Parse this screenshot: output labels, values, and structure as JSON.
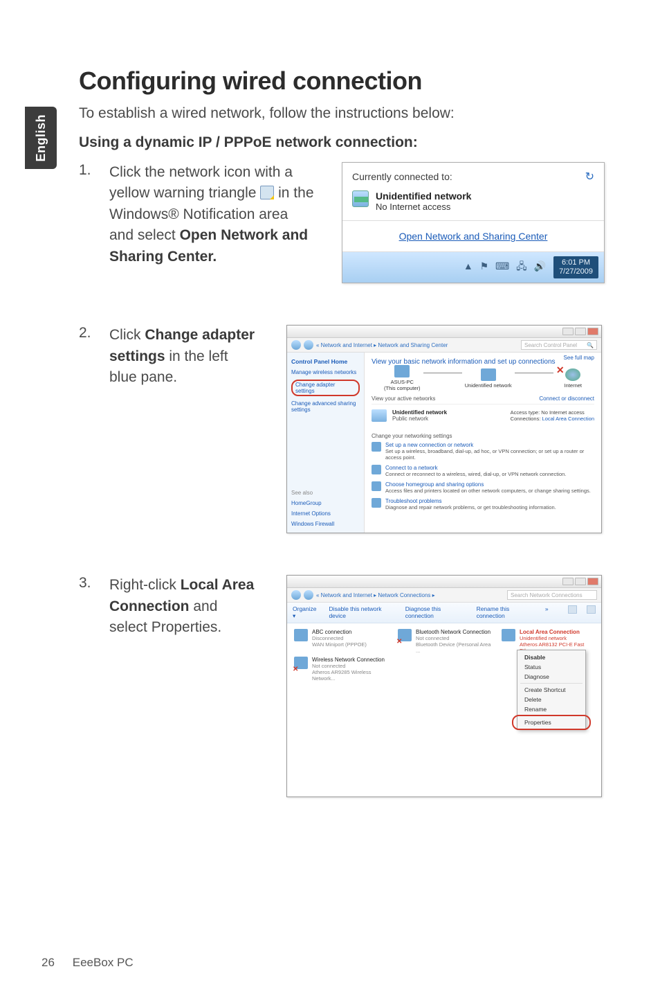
{
  "sideTab": "English",
  "headline": "Configuring wired connection",
  "intro": "To establish a wired network, follow the instructions below:",
  "subhead": "Using a dynamic IP / PPPoE network connection:",
  "steps": {
    "s1": {
      "num": "1.",
      "pre": "Click the network icon with a yellow warning triangle ",
      "mid": " in the Windows® Notification area and select ",
      "bold": "Open Network and Sharing Center."
    },
    "s2": {
      "num": "2.",
      "pre": "Click ",
      "bold": "Change adapter settings",
      "post": " in the left blue pane."
    },
    "s3": {
      "num": "3.",
      "pre": "Right-click ",
      "bold": "Local Area Connection",
      "post": " and select Properties."
    }
  },
  "shot1": {
    "header": "Currently connected to:",
    "refreshGlyph": "↻",
    "netTitle": "Unidentified network",
    "netSub": "No Internet access",
    "link": "Open Network and Sharing Center",
    "trayGlyphs": "▲ ⚑ ⌨ 🖧 🔊",
    "time": "6:01 PM",
    "date": "7/27/2009"
  },
  "shot2": {
    "breadcrumb": "« Network and Internet ▸ Network and Sharing Center",
    "searchPlaceholder": "Search Control Panel",
    "left": {
      "home": "Control Panel Home",
      "l1": "Manage wireless networks",
      "l2": "Change adapter settings",
      "l3": "Change advanced sharing settings",
      "seeAlso": "See also",
      "sa1": "HomeGroup",
      "sa2": "Internet Options",
      "sa3": "Windows Firewall"
    },
    "right": {
      "title": "View your basic network information and set up connections",
      "seeFullMap": "See full map",
      "node1": "ASUS-PC",
      "node1sub": "(This computer)",
      "node2": "Unidentified network",
      "node3": "Internet",
      "activeHdr": "View your active networks",
      "connDisc": "Connect or disconnect",
      "netName": "Unidentified network",
      "netType": "Public network",
      "accessLabel": "Access type:",
      "accessVal": "No Internet access",
      "connLabel": "Connections:",
      "connVal": "Local Area Connection",
      "changeHdr": "Change your networking settings",
      "opt1t": "Set up a new connection or network",
      "opt1d": "Set up a wireless, broadband, dial-up, ad hoc, or VPN connection; or set up a router or access point.",
      "opt2t": "Connect to a network",
      "opt2d": "Connect or reconnect to a wireless, wired, dial-up, or VPN network connection.",
      "opt3t": "Choose homegroup and sharing options",
      "opt3d": "Access files and printers located on other network computers, or change sharing settings.",
      "opt4t": "Troubleshoot problems",
      "opt4d": "Diagnose and repair network problems, or get troubleshooting information."
    }
  },
  "shot3": {
    "breadcrumb": "« Network and Internet ▸ Network Connections ▸",
    "searchPlaceholder": "Search Network Connections",
    "toolbar": {
      "organize": "Organize ▾",
      "disable": "Disable this network device",
      "diagnose": "Diagnose this connection",
      "rename": "Rename this connection",
      "more": "»"
    },
    "conns": {
      "c1n": "ABC connection",
      "c1s": "Disconnected",
      "c1d": "WAN Miniport (PPPOE)",
      "c2n": "Bluetooth Network Connection",
      "c2s": "Not connected",
      "c2d": "Bluetooth Device (Personal Area ...",
      "c3n": "Local Area Connection",
      "c3s": "Unidentified network",
      "c3d": "Atheros AR8132 PCI-E Fast Ethern...",
      "c4n": "Wireless Network Connection",
      "c4s": "Not connected",
      "c4d": "Atheros AR9285 Wireless Network..."
    },
    "menu": {
      "m1": "Disable",
      "m2": "Status",
      "m3": "Diagnose",
      "m4": "Create Shortcut",
      "m5": "Delete",
      "m6": "Rename",
      "m7": "Properties"
    }
  },
  "footer": {
    "page": "26",
    "product": "EeeBox PC"
  }
}
